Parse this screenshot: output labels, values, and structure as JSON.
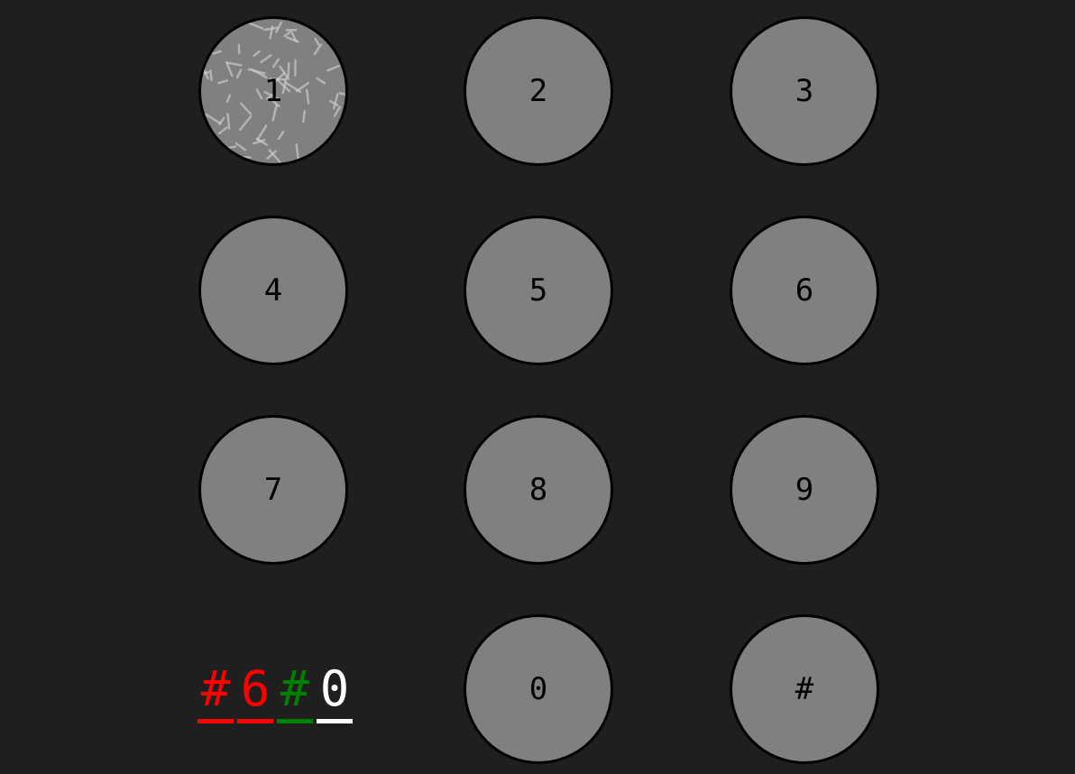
{
  "keypad": {
    "keys": [
      {
        "label": "1",
        "row": 0,
        "col": 0
      },
      {
        "label": "2",
        "row": 0,
        "col": 1
      },
      {
        "label": "3",
        "row": 0,
        "col": 2
      },
      {
        "label": "4",
        "row": 1,
        "col": 0
      },
      {
        "label": "5",
        "row": 1,
        "col": 1
      },
      {
        "label": "6",
        "row": 1,
        "col": 2
      },
      {
        "label": "7",
        "row": 2,
        "col": 0
      },
      {
        "label": "8",
        "row": 2,
        "col": 1
      },
      {
        "label": "9",
        "row": 2,
        "col": 2
      },
      {
        "label": "0",
        "row": 3,
        "col": 1
      },
      {
        "label": "#",
        "row": 3,
        "col": 2
      }
    ]
  },
  "code_display": {
    "chars": [
      {
        "char": "#",
        "color": "#ff0000"
      },
      {
        "char": "6",
        "color": "#ff0000"
      },
      {
        "char": "#",
        "color": "#008000"
      },
      {
        "char": "0",
        "color": "#ffffff"
      }
    ]
  },
  "colors": {
    "background": "#1f1f1f",
    "key_fill": "#808080",
    "key_border": "#000000"
  }
}
